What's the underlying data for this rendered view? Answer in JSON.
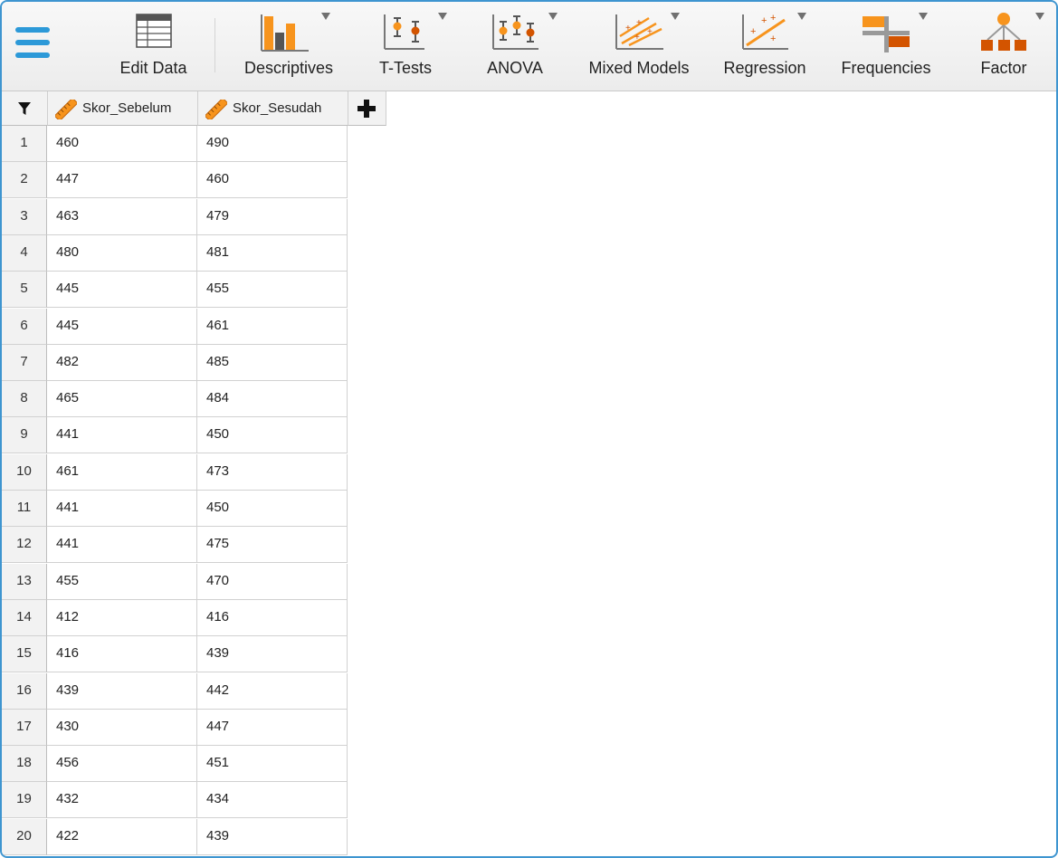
{
  "toolbar": {
    "items": [
      {
        "label": "Edit Data",
        "icon": "edit-data-icon"
      },
      {
        "label": "Descriptives",
        "icon": "descriptives-icon"
      },
      {
        "label": "T-Tests",
        "icon": "ttests-icon"
      },
      {
        "label": "ANOVA",
        "icon": "anova-icon"
      },
      {
        "label": "Mixed Models",
        "icon": "mixed-models-icon"
      },
      {
        "label": "Regression",
        "icon": "regression-icon"
      },
      {
        "label": "Frequencies",
        "icon": "frequencies-icon"
      },
      {
        "label": "Factor",
        "icon": "factor-icon"
      }
    ],
    "accent": "#2c99d8",
    "icon_orange": "#f7941d",
    "icon_dark": "#d35400"
  },
  "grid": {
    "columns": [
      "Skor_Sebelum",
      "Skor_Sesudah"
    ],
    "rows": [
      {
        "n": "1",
        "a": "460",
        "b": "490"
      },
      {
        "n": "2",
        "a": "447",
        "b": "460"
      },
      {
        "n": "3",
        "a": "463",
        "b": "479"
      },
      {
        "n": "4",
        "a": "480",
        "b": "481"
      },
      {
        "n": "5",
        "a": "445",
        "b": "455"
      },
      {
        "n": "6",
        "a": "445",
        "b": "461"
      },
      {
        "n": "7",
        "a": "482",
        "b": "485"
      },
      {
        "n": "8",
        "a": "465",
        "b": "484"
      },
      {
        "n": "9",
        "a": "441",
        "b": "450"
      },
      {
        "n": "10",
        "a": "461",
        "b": "473"
      },
      {
        "n": "11",
        "a": "441",
        "b": "450"
      },
      {
        "n": "12",
        "a": "441",
        "b": "475"
      },
      {
        "n": "13",
        "a": "455",
        "b": "470"
      },
      {
        "n": "14",
        "a": "412",
        "b": "416"
      },
      {
        "n": "15",
        "a": "416",
        "b": "439"
      },
      {
        "n": "16",
        "a": "439",
        "b": "442"
      },
      {
        "n": "17",
        "a": "430",
        "b": "447"
      },
      {
        "n": "18",
        "a": "456",
        "b": "451"
      },
      {
        "n": "19",
        "a": "432",
        "b": "434"
      },
      {
        "n": "20",
        "a": "422",
        "b": "439"
      }
    ]
  }
}
